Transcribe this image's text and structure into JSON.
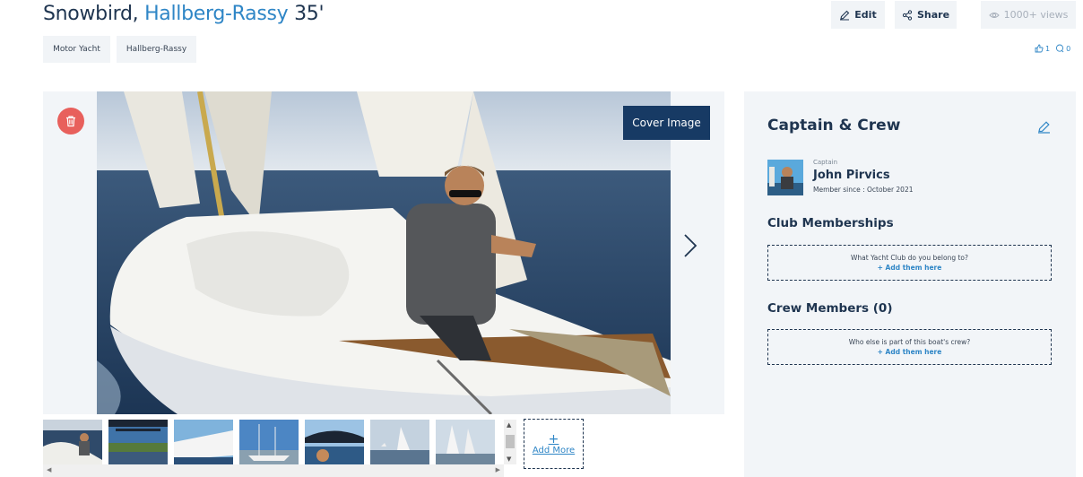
{
  "listing": {
    "name": "Snowbird,",
    "model": "Hallberg-Rassy",
    "length": "35'"
  },
  "tags": [
    "Motor Yacht",
    "Hallberg-Rassy"
  ],
  "actions": {
    "edit_label": "Edit",
    "share_label": "Share",
    "views_label": "1000+ views"
  },
  "stats": {
    "likes": "1",
    "comments": "0"
  },
  "gallery": {
    "cover_label": "Cover Image",
    "add_more_label": "Add More",
    "thumbnail_count": 7
  },
  "panel": {
    "title": "Captain & Crew",
    "captain": {
      "role": "Captain",
      "name": "John Pirvics",
      "member_since": "Member since : October 2021"
    },
    "club": {
      "heading": "Club Memberships",
      "prompt": "What Yacht Club do you belong to?",
      "link": "+ Add them here"
    },
    "crew": {
      "heading": "Crew Members (0)",
      "prompt": "Who else is part of this boat's crew?",
      "link": "+ Add them here"
    }
  },
  "colors": {
    "accent": "#2f86c6",
    "navy": "#173a64",
    "delete": "#e8605c",
    "panel_bg": "#f2f5f8"
  }
}
